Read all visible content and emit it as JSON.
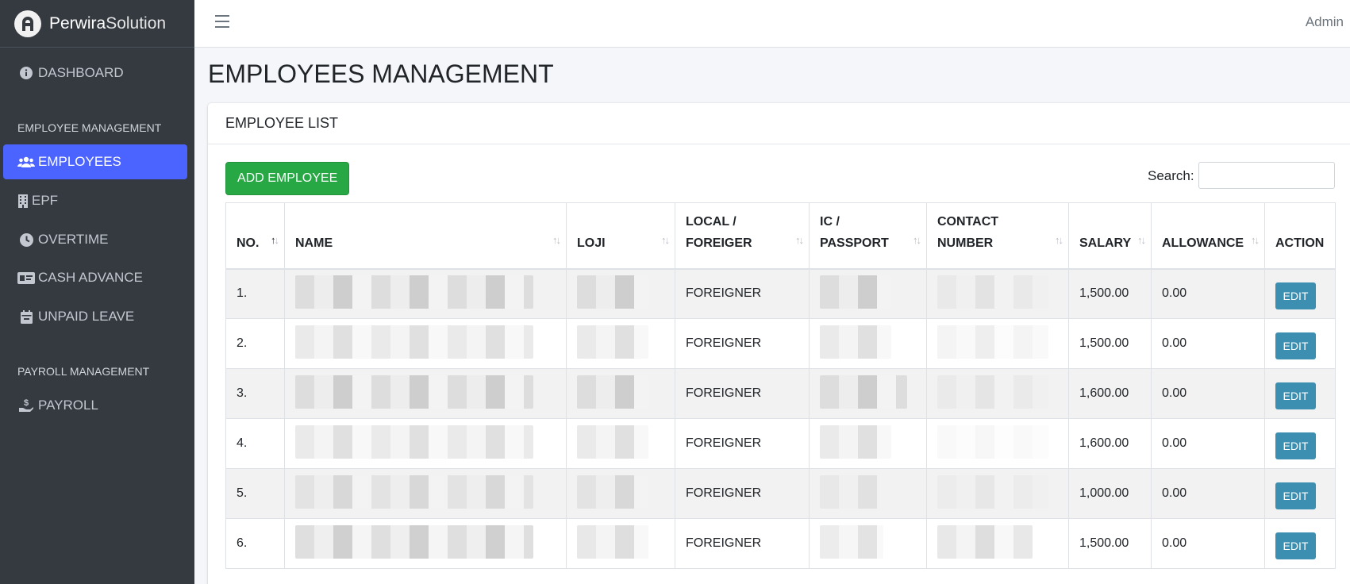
{
  "app": {
    "brand_bold": "Perwira",
    "brand_light": "Solution",
    "user": "Admin"
  },
  "sidebar": {
    "dashboard": "DASHBOARD",
    "header_employee": "EMPLOYEE MANAGEMENT",
    "employees": "EMPLOYEES",
    "epf": "EPF",
    "overtime": "OVERTIME",
    "cash_advance": "CASH ADVANCE",
    "unpaid_leave": "UNPAID LEAVE",
    "header_payroll": "PAYROLL MANAGEMENT",
    "payroll": "PAYROLL"
  },
  "page": {
    "title": "EMPLOYEES MANAGEMENT",
    "card_title": "EMPLOYEE LIST",
    "add_button": "ADD EMPLOYEE",
    "search_label": "Search:"
  },
  "table": {
    "headers": {
      "no": "NO.",
      "name": "NAME",
      "loji": "LOJI",
      "local_1": "LOCAL /",
      "local_2": "FOREIGER",
      "ic_1": "IC /",
      "ic_2": "PASSPORT",
      "contact_1": "CONTACT",
      "contact_2": "NUMBER",
      "salary": "SALARY",
      "allowance": "ALLOWANCE",
      "action": "ACTION"
    },
    "rows": [
      {
        "no": "1.",
        "type": "FOREIGNER",
        "salary": "1,500.00",
        "allowance": "0.00",
        "action": "EDIT"
      },
      {
        "no": "2.",
        "type": "FOREIGNER",
        "salary": "1,500.00",
        "allowance": "0.00",
        "action": "EDIT"
      },
      {
        "no": "3.",
        "type": "FOREIGNER",
        "salary": "1,600.00",
        "allowance": "0.00",
        "action": "EDIT"
      },
      {
        "no": "4.",
        "type": "FOREIGNER",
        "salary": "1,600.00",
        "allowance": "0.00",
        "action": "EDIT"
      },
      {
        "no": "5.",
        "type": "FOREIGNER",
        "salary": "1,000.00",
        "allowance": "0.00",
        "action": "EDIT"
      },
      {
        "no": "6.",
        "type": "FOREIGNER",
        "salary": "1,500.00",
        "allowance": "0.00",
        "action": "EDIT"
      }
    ]
  },
  "colors": {
    "sidebar_bg": "#343a40",
    "active": "#4b63ff",
    "add_button": "#28a745",
    "edit_button": "#3c8fb0"
  }
}
